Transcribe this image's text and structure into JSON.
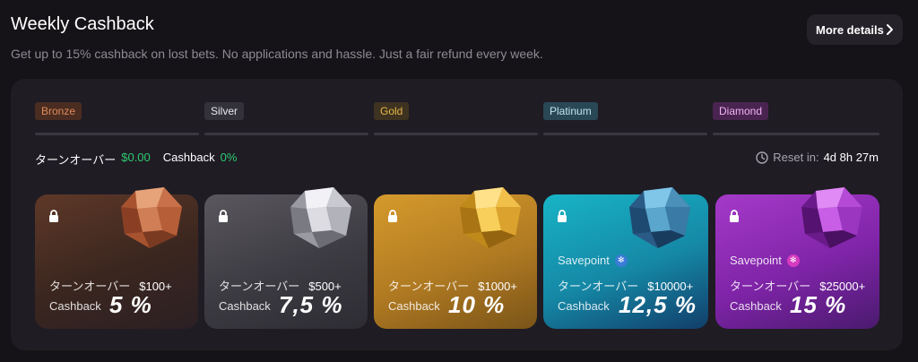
{
  "header": {
    "title": "Weekly Cashback",
    "subtitle": "Get up to 15% cashback on lost bets. No applications and hassle. Just a fair refund every week.",
    "more_label": "More details"
  },
  "tiers": [
    {
      "label": "Bronze",
      "bg": "#4a2c20",
      "fg": "#e08a5c"
    },
    {
      "label": "Silver",
      "bg": "#33313a",
      "fg": "#e8e8ee"
    },
    {
      "label": "Gold",
      "bg": "#3d3320",
      "fg": "#e7b548"
    },
    {
      "label": "Platinum",
      "bg": "#2a4756",
      "fg": "#bfe3f2"
    },
    {
      "label": "Diamond",
      "bg": "#4a2450",
      "fg": "#f0b2f5"
    }
  ],
  "stats": {
    "turnover_label": "ターンオーバー",
    "turnover_value": "$0.00",
    "cashback_label": "Cashback",
    "cashback_value": "0%",
    "reset_label": "Reset in:",
    "reset_value": "4d 8h 27m"
  },
  "cards": [
    {
      "tier": "Bronze",
      "turnover_label": "ターンオーバー",
      "turnover": "$100+",
      "cashback_label": "Cashback",
      "percent": "5 %",
      "savepoint": ""
    },
    {
      "tier": "Silver",
      "turnover_label": "ターンオーバー",
      "turnover": "$500+",
      "cashback_label": "Cashback",
      "percent": "7,5 %",
      "savepoint": ""
    },
    {
      "tier": "Gold",
      "turnover_label": "ターンオーバー",
      "turnover": "$1000+",
      "cashback_label": "Cashback",
      "percent": "10 %",
      "savepoint": ""
    },
    {
      "tier": "Platinum",
      "turnover_label": "ターンオーバー",
      "turnover": "$10000+",
      "cashback_label": "Cashback",
      "percent": "12,5 %",
      "savepoint": "Savepoint"
    },
    {
      "tier": "Diamond",
      "turnover_label": "ターンオーバー",
      "turnover": "$25000+",
      "cashback_label": "Cashback",
      "percent": "15 %",
      "savepoint": "Savepoint"
    }
  ],
  "colors": {
    "turnover_green": "#2ecc71",
    "bronze": "#5b3526",
    "silver": "#4a484f",
    "gold": "#c48a28",
    "platinum": "#1aa3b8",
    "diamond": "#8a2bb0"
  }
}
